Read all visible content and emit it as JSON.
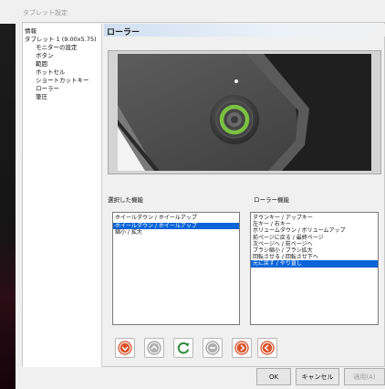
{
  "window": {
    "title": "タブレット設定"
  },
  "tree": {
    "items": [
      {
        "label": "情報"
      },
      {
        "label": "タブレット 1 (9.00x5.75)"
      },
      {
        "label": "モニターの設定"
      },
      {
        "label": "ボタン"
      },
      {
        "label": "範囲"
      },
      {
        "label": "ホットセル"
      },
      {
        "label": "ショートカットキー"
      },
      {
        "label": "ローラー"
      },
      {
        "label": "筆圧"
      }
    ]
  },
  "content": {
    "title": "ローラー"
  },
  "selected_functions": {
    "label": "選択した機能",
    "items": [
      {
        "label": "ホイールダウン / ホイールアップ"
      },
      {
        "label": "ホイールダウン / ホイールアップ",
        "selected": true
      },
      {
        "label": "縮小 / 拡大"
      }
    ]
  },
  "roller_functions": {
    "label": "ローラー機能",
    "items": [
      {
        "label": "ダウンキー / アップキー"
      },
      {
        "label": "左キー / 右キー"
      },
      {
        "label": "ボリュームダウン / ボリュームアップ"
      },
      {
        "label": "前ページに戻る / 最終ページ"
      },
      {
        "label": "次ページへ / 前ページへ"
      },
      {
        "label": "ブラシ縮小 / ブラシ拡大"
      },
      {
        "label": "回転させる / 回転させ下へ"
      },
      {
        "label": "元に戻す / やり直し",
        "selected": true
      }
    ]
  },
  "actions": [
    {
      "icon": "arrow-down-circle-icon",
      "color": "#d9542b",
      "enabled": true
    },
    {
      "icon": "arrow-up-circle-icon",
      "color": "#a0a0a0",
      "enabled": false
    },
    {
      "icon": "refresh-icon",
      "color": "#2e8b3c",
      "enabled": true
    },
    {
      "icon": "remove-circle-icon",
      "color": "#a0a0a0",
      "enabled": false
    },
    {
      "icon": "arrow-right-circle-icon",
      "color": "#d9542b",
      "enabled": true
    },
    {
      "icon": "arrow-left-circle-icon",
      "color": "#d9542b",
      "enabled": true
    }
  ],
  "dialog_buttons": {
    "ok": "OK",
    "cancel": "キャンセル",
    "apply": "適用(A)"
  },
  "colors": {
    "accent_green": "#7bc142",
    "selection_blue": "#0a64d8",
    "title_bar": "#d0dff0"
  }
}
